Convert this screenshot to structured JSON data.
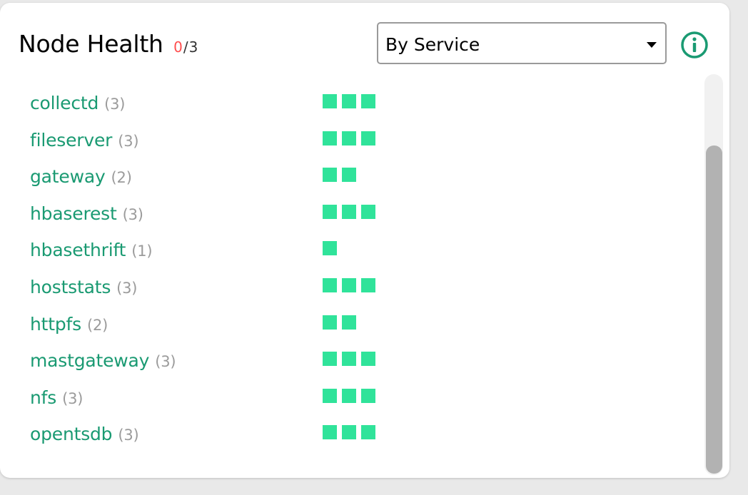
{
  "header": {
    "title": "Node Health",
    "failed": "0",
    "separator": "/",
    "total": "3"
  },
  "group_select": {
    "value": "By Service"
  },
  "info_icon": "info-circle-icon",
  "colors": {
    "accent": "#1a9a72",
    "healthy": "#30e39a",
    "failed": "#ff4d4d",
    "muted": "#9b9b9b"
  },
  "services": [
    {
      "name": "collectd",
      "count": "(3)",
      "nodes": 3
    },
    {
      "name": "fileserver",
      "count": "(3)",
      "nodes": 3
    },
    {
      "name": "gateway",
      "count": "(2)",
      "nodes": 2
    },
    {
      "name": "hbaserest",
      "count": "(3)",
      "nodes": 3
    },
    {
      "name": "hbasethrift",
      "count": "(1)",
      "nodes": 1
    },
    {
      "name": "hoststats",
      "count": "(3)",
      "nodes": 3
    },
    {
      "name": "httpfs",
      "count": "(2)",
      "nodes": 2
    },
    {
      "name": "mastgateway",
      "count": "(3)",
      "nodes": 3
    },
    {
      "name": "nfs",
      "count": "(3)",
      "nodes": 3
    },
    {
      "name": "opentsdb",
      "count": "(3)",
      "nodes": 3
    }
  ]
}
